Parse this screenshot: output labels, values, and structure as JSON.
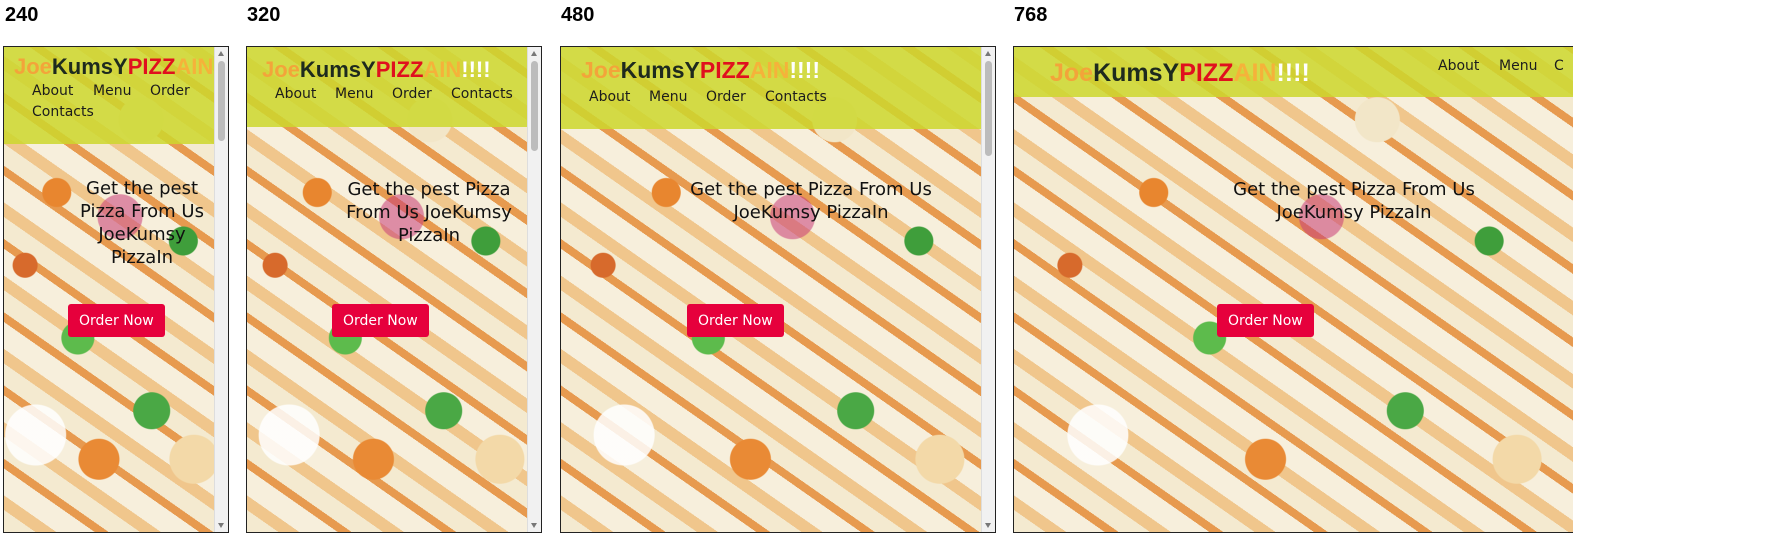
{
  "labels": [
    "240",
    "320",
    "480",
    "768"
  ],
  "logo": {
    "joe": "Joe",
    "kums": "KumsY",
    "pizz": "PIZZ",
    "ain": "AIN",
    "bang": "!!!!"
  },
  "nav": {
    "about": "About",
    "menu": "Menu",
    "order": "Order",
    "contacts": "Contacts",
    "contacts_short": "C"
  },
  "hero": {
    "headline": "Get the pest Pizza From Us JoeKumsy PizzaIn",
    "button": "Order Now"
  },
  "colors": {
    "header": "#cdd72d",
    "button": "#e6003c",
    "logo_red": "#e0101e",
    "logo_orange": "#f3a43a"
  }
}
